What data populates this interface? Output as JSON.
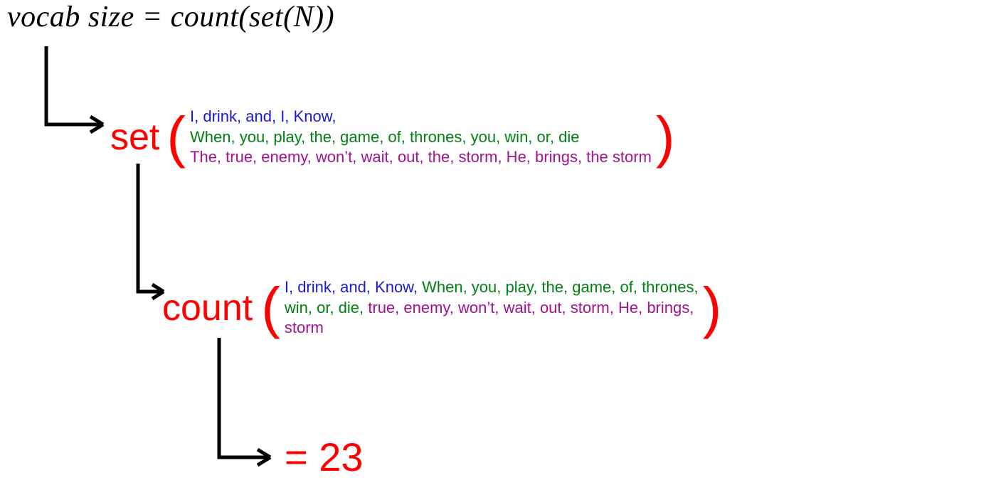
{
  "formula": "vocab size = count(set(N))",
  "set": {
    "fn": "set",
    "lparen": "(",
    "rparen": ")",
    "line1": "I, drink, and, I, Know,",
    "line2": "When, you, play, the, game, of, thrones, you, win, or, die",
    "line3": "The, true, enemy, won’t, wait, out, the, storm, He, brings, the storm"
  },
  "count": {
    "fn": "count",
    "lparen": "(",
    "rparen": ")",
    "seg_blue": "I, drink, and, Know, ",
    "seg_green1": "When, you, play, the, game, of, thrones,",
    "seg_green2": "win, or, die, ",
    "seg_purple": "true, enemy, won’t, wait, out, storm, He, brings,",
    "storm": "storm"
  },
  "result": "= 23"
}
